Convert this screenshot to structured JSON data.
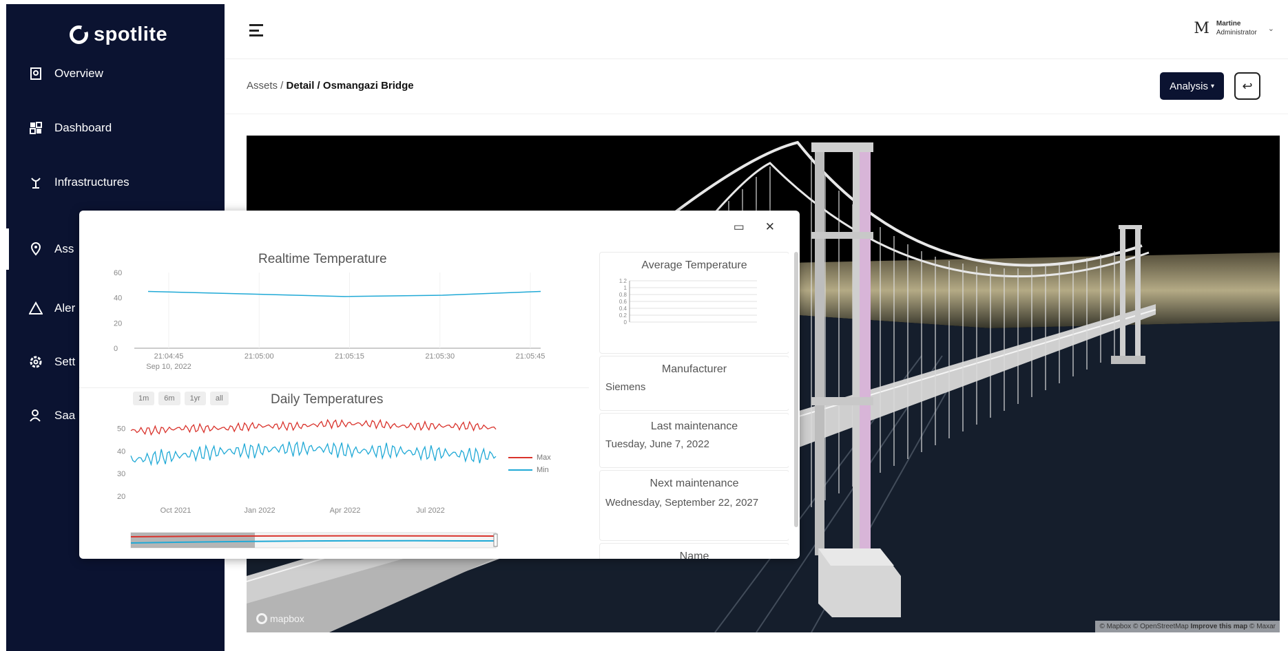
{
  "app": {
    "name": "spotlite"
  },
  "sidebar": {
    "items": [
      {
        "label": "Overview",
        "icon": "overview-icon"
      },
      {
        "label": "Dashboard",
        "icon": "dashboard-icon"
      },
      {
        "label": "Infrastructures",
        "icon": "infrastructure-icon"
      },
      {
        "label": "Ass",
        "icon": "location-pin-icon"
      },
      {
        "label": "Aler",
        "icon": "alert-triangle-icon"
      },
      {
        "label": "Sett",
        "icon": "gear-icon"
      },
      {
        "label": "Saa",
        "icon": "user-icon"
      }
    ]
  },
  "topbar": {
    "avatar_initial": "M",
    "user_name": "Martine",
    "user_role": "Administrator"
  },
  "breadcrumb": {
    "root": "Assets",
    "sep1": " / ",
    "level2": "Detail",
    "sep2": " / ",
    "current": "Osmangazi Bridge"
  },
  "actions": {
    "analysis_label": "Analysis"
  },
  "map": {
    "logo_text": "mapbox",
    "attribution_text": "© Mapbox © OpenStreetMap ",
    "attribution_improve": "Improve this map",
    "attribution_end": " © Maxar"
  },
  "popup": {
    "realtime_title": "Realtime Temperature",
    "daily_title": "Daily Temperatures",
    "range_buttons": [
      "1m",
      "6m",
      "1yr",
      "all"
    ],
    "cards": [
      {
        "title": "Average Temperature",
        "value": ""
      },
      {
        "title": "Manufacturer",
        "value": "Siemens"
      },
      {
        "title": "Last maintenance",
        "value": "Tuesday, June 7, 2022"
      },
      {
        "title": "Next maintenance",
        "value": "Wednesday, September 22, 2027"
      },
      {
        "title": "Name",
        "value": ""
      }
    ]
  },
  "chart_data": [
    {
      "type": "line",
      "title": "Realtime Temperature",
      "x": [
        "21:04:45",
        "21:05:00",
        "21:05:15",
        "21:05:30",
        "21:05:45"
      ],
      "x_sub": "Sep 10, 2022",
      "series": [
        {
          "values": [
            45,
            43,
            41,
            42,
            45
          ]
        }
      ],
      "ylim": [
        0,
        60
      ],
      "yticks": [
        0,
        20,
        40,
        60
      ],
      "color": "#1fa9d6"
    },
    {
      "type": "line",
      "title": "Daily Temperatures",
      "xticks": [
        "Oct 2021",
        "Jan 2022",
        "Apr 2022",
        "Jul 2022"
      ],
      "yticks": [
        20,
        30,
        40,
        50
      ],
      "ylim": [
        20,
        55
      ],
      "legend": "right",
      "series": [
        {
          "name": "Max",
          "color": "#d9322b",
          "values": [
            49,
            49,
            50,
            50,
            50,
            51,
            51,
            51,
            52,
            52,
            52,
            51,
            51,
            51,
            51,
            50
          ]
        },
        {
          "name": "Min",
          "color": "#1fa9d6",
          "values": [
            36,
            37,
            38,
            39,
            40,
            40,
            41,
            41,
            41,
            40,
            40,
            40,
            39,
            39,
            38,
            38
          ]
        }
      ]
    },
    {
      "type": "bar",
      "title": "Average Temperature",
      "yticks": [
        "0",
        "0.2",
        "0.4",
        "0.6",
        "0.8",
        "1",
        "1.2"
      ],
      "ylim": [
        0,
        1.2
      ],
      "values": []
    }
  ]
}
